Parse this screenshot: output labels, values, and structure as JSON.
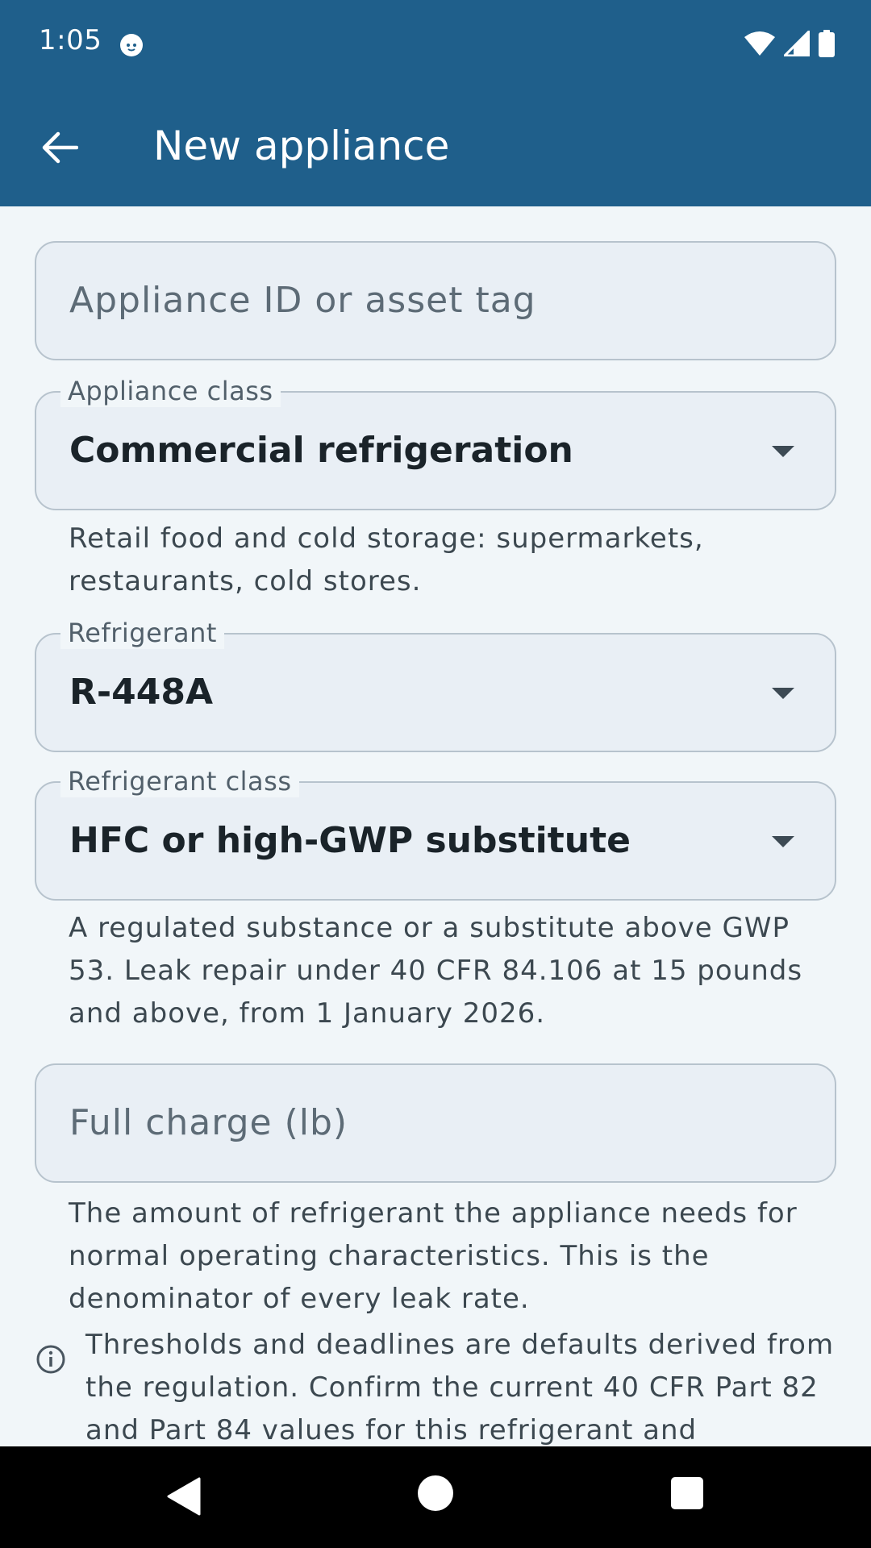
{
  "status_bar": {
    "time": "1:05",
    "icons": [
      "cat-notification-icon",
      "wifi-icon",
      "signal-icon",
      "battery-icon"
    ]
  },
  "app_bar": {
    "title": "New appliance",
    "back_icon": "arrow-back-icon"
  },
  "form": {
    "appliance_id": {
      "value": "",
      "placeholder": "Appliance ID or asset tag"
    },
    "appliance_class": {
      "label": "Appliance class",
      "value": "Commercial refrigeration",
      "helper": "Retail food and cold storage: supermarkets, restaurants, cold stores."
    },
    "refrigerant": {
      "label": "Refrigerant",
      "value": "R-448A"
    },
    "refrigerant_class": {
      "label": "Refrigerant class",
      "value": "HFC or high-GWP substitute",
      "helper": "A regulated substance or a substitute above GWP 53. Leak repair under 40 CFR 84.106 at 15 pounds and above, from 1 January 2026."
    },
    "full_charge": {
      "value": "",
      "placeholder": "Full charge (lb)",
      "helper": "The amount of refrigerant the appliance needs for normal operating characteristics. This is the denominator of every leak rate."
    }
  },
  "info_note": {
    "icon": "info-icon",
    "text": "Thresholds and deadlines are defaults derived from the regulation. Confirm the current 40 CFR Part 82 and Part 84 values for this refrigerant and"
  },
  "colors": {
    "app_bar": "#1f5f8b",
    "background": "#f1f6f9",
    "field_fill": "#e9eff5",
    "field_border": "#b7c3cd"
  }
}
